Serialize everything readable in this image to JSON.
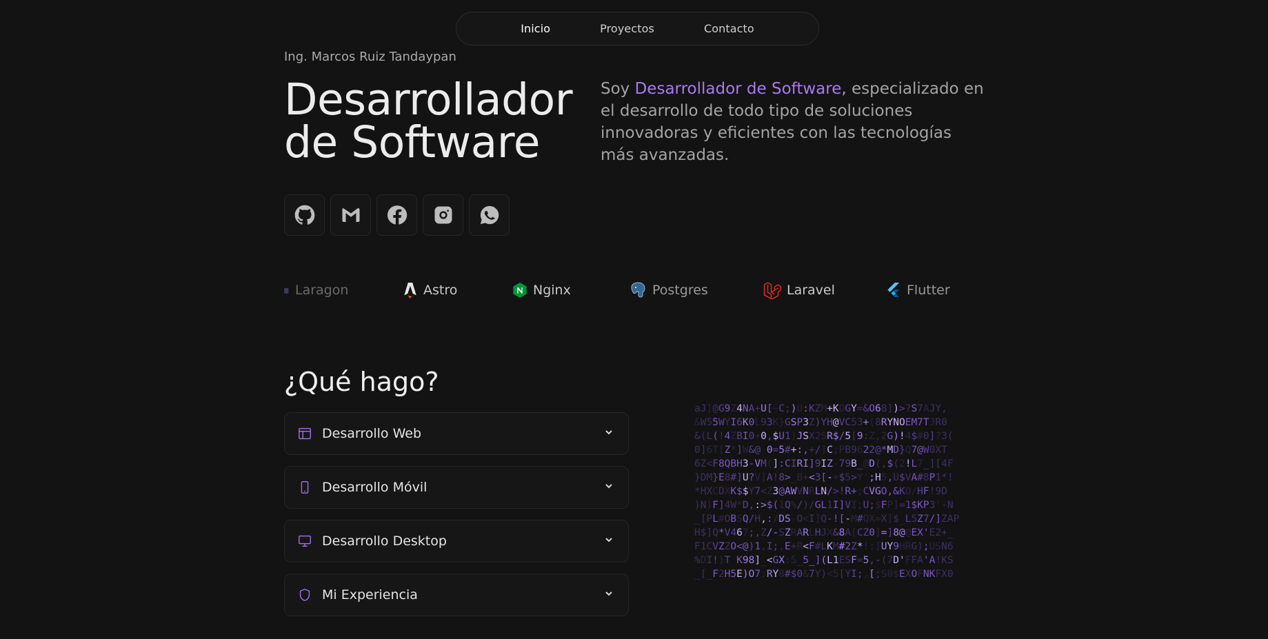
{
  "nav": {
    "items": [
      {
        "label": "Inicio",
        "active": true
      },
      {
        "label": "Proyectos",
        "active": false
      },
      {
        "label": "Contacto",
        "active": false
      }
    ]
  },
  "hero": {
    "subtitle": "Ing. Marcos Ruiz Tandaypan",
    "title_line1": "Desarrollador",
    "title_line2": "de Software",
    "desc_prefix": "Soy ",
    "desc_accent": "Desarrollador de Software",
    "desc_suffix": ", especializado en el desarrollo de todo tipo de soluciones innovadoras y eficientes con las tecnologías más avanzadas.",
    "accent_color": "#a77bef"
  },
  "socials": [
    {
      "name": "github-icon"
    },
    {
      "name": "gmail-icon"
    },
    {
      "name": "facebook-icon"
    },
    {
      "name": "instagram-icon"
    },
    {
      "name": "whatsapp-icon"
    }
  ],
  "technologies": [
    {
      "label": "Laragon",
      "icon": "laragon-icon"
    },
    {
      "label": "Astro",
      "icon": "astro-icon"
    },
    {
      "label": "Nginx",
      "icon": "nginx-icon"
    },
    {
      "label": "Postgres",
      "icon": "postgres-icon"
    },
    {
      "label": "Laravel",
      "icon": "laravel-icon"
    },
    {
      "label": "Flutter",
      "icon": "flutter-icon"
    }
  ],
  "services": {
    "title": "¿Qué hago?",
    "items": [
      {
        "label": "Desarrollo Web",
        "icon": "browser-window-icon"
      },
      {
        "label": "Desarrollo Móvil",
        "icon": "smartphone-icon"
      },
      {
        "label": "Desarrollo Desktop",
        "icon": "monitor-icon"
      },
      {
        "label": "Mi Experiencia",
        "icon": "shield-icon"
      }
    ]
  },
  "matrix_lines": [
    "aJ]@G9Z4NA+U[~C;)U:KZM+KOGY=&O68])>?S7AJY,",
    "&W55WYI6K0L93K}GSP3Z)YH@VC53+(8RYNOEM7TJR0",
    "&(L(!4ZBI0+0,$U1)JSX2SR$/5[9:Z,2G)!4$#0]?3(",
    "0]6T[Z*]W&@ 0=5#+:,+/]C;PB9622@*MD}Q7@W0XT",
    "6Z<F8QBH3-VM(]:CIRI]9IZ-79B_@D(,$(2!L7_][4F",
    "}DM}E8#]U?V]A!8>_B+<3[-+$5>Y';H5,U$VA#8P1*!",
    "*HXCDXK$$Y7<Z3@AWVNRLN/>!R+;CVGO,&KO/HF!9D",
    ")N)F]4W*D,:>$(1Q%/)/GL1I]VI;U;$FP]=1$KP3'-N",
    "_[PL#OBSQ/H,:/DS-O<I]Q-![-M#QX=X]$_L5Z7/]ZAP",
    "H$]Q*V467;,Z/-SZRARLHJX&8A[CZ0]=]8@@EX'E2+_",
    "F1CVZZO<@)1,I;,E+R<F#LKM#2Z*!:]UY9HRG);USN6",
    "%DI!)T K98]_<GX:5_5_](L1ESF=5,-(7D'FFA'A!KS",
    "_[_F2H5E)O7:RY8#$0&7Y)<5[YI;,[;S0$EXOFNKFX0"
  ]
}
